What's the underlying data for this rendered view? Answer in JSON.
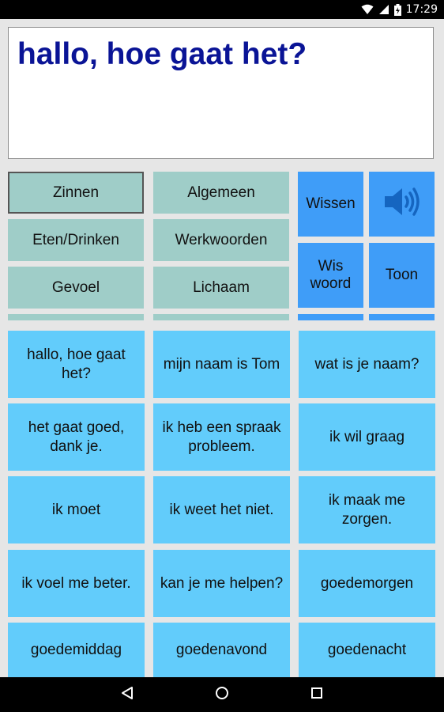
{
  "status_bar": {
    "time": "17:29",
    "icons": [
      "wifi-icon",
      "signal-icon",
      "battery-charging-icon"
    ]
  },
  "output": {
    "text": "hallo, hoe gaat het?"
  },
  "categories": [
    {
      "label": "Zinnen",
      "selected": true
    },
    {
      "label": "Algemeen",
      "selected": false
    },
    {
      "label": "Eten/Drinken",
      "selected": false
    },
    {
      "label": "Werkwoorden",
      "selected": false
    },
    {
      "label": "Gevoel",
      "selected": false
    },
    {
      "label": "Lichaam",
      "selected": false
    }
  ],
  "controls": {
    "clear_label": "Wissen",
    "speak_icon": "speaker-icon",
    "delete_word_label": "Wis woord",
    "show_label": "Toon"
  },
  "phrases": [
    "hallo, hoe gaat het?",
    "mijn naam is Tom",
    "wat is je naam?",
    "het gaat goed, dank je.",
    "ik heb een spraak probleem.",
    "ik wil graag",
    "ik moet",
    "ik weet het niet.",
    "ik maak me zorgen.",
    "ik voel me beter.",
    "kan je me helpen?",
    "goedemorgen",
    "goedemiddag",
    "goedenavond",
    "goedenacht"
  ],
  "colors": {
    "output_text": "#0a1496",
    "category": "#9fcdc8",
    "control": "#3f9df8",
    "phrase": "#62ccfb"
  },
  "nav_bar": {
    "icons": [
      "back-icon",
      "home-icon",
      "recents-icon"
    ]
  }
}
